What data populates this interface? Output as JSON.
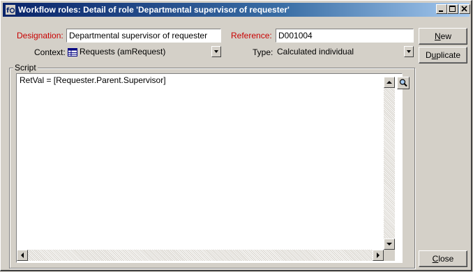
{
  "window": {
    "title": "Workflow roles: Detail of role 'Departmental supervisor of requester'",
    "title_icon": "workflow-role-icon",
    "controls": [
      "minimize-icon",
      "maximize-icon",
      "close-icon"
    ]
  },
  "form": {
    "designation_label": "Designation:",
    "designation_value": "Departmental supervisor of requester",
    "reference_label": "Reference:",
    "reference_value": "D001004",
    "context_label": "Context:",
    "context_value": "Requests (amRequest)",
    "type_label": "Type:",
    "type_value": "Calculated individual"
  },
  "script": {
    "group_label": "Script",
    "code": "RetVal = [Requester.Parent.Supervisor]"
  },
  "buttons": {
    "new_accel": "N",
    "new_rest": "ew",
    "duplicate_first": "D",
    "duplicate_accel": "u",
    "duplicate_rest": "plicate",
    "close_accel": "C",
    "close_rest": "lose"
  },
  "colors": {
    "required_label": "#c80000",
    "titlebar_start": "#0a246a",
    "titlebar_end": "#a6caf0",
    "face": "#d4d0c8"
  }
}
